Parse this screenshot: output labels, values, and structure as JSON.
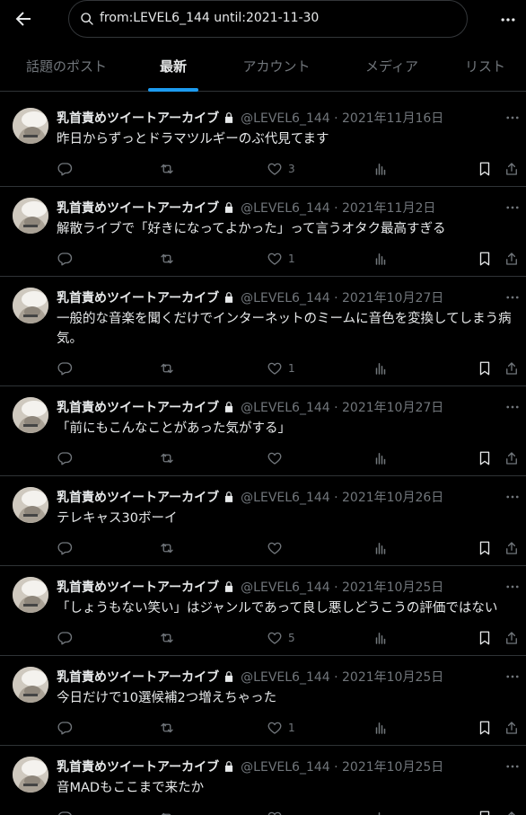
{
  "search": {
    "query": "from:LEVEL6_144 until:2021-11-30"
  },
  "tabs": [
    {
      "label": "話題のポスト",
      "active": false
    },
    {
      "label": "最新",
      "active": true
    },
    {
      "label": "アカウント",
      "active": false
    },
    {
      "label": "メディア",
      "active": false
    },
    {
      "label": "リスト",
      "active": false
    }
  ],
  "tweets": [
    {
      "name": "乳首責めツイートアーカイブ",
      "meta": "@LEVEL6_144 · 2021年11月16日",
      "text": "昨日からずっとドラマツルギーのぶ代見てます",
      "likes": "3"
    },
    {
      "name": "乳首責めツイートアーカイブ",
      "meta": "@LEVEL6_144 · 2021年11月2日",
      "text": "解散ライブで「好きになってよかった」って言うオタク最高すぎる",
      "likes": "1"
    },
    {
      "name": "乳首責めツイートアーカイブ",
      "meta": "@LEVEL6_144 · 2021年10月27日",
      "text": "一般的な音楽を聞くだけでインターネットのミームに音色を変換してしまう病気。",
      "likes": "1"
    },
    {
      "name": "乳首責めツイートアーカイブ",
      "meta": "@LEVEL6_144 · 2021年10月27日",
      "text": "「前にもこんなことがあった気がする」",
      "likes": ""
    },
    {
      "name": "乳首責めツイートアーカイブ",
      "meta": "@LEVEL6_144 · 2021年10月26日",
      "text": "テレキャス30ボーイ",
      "likes": ""
    },
    {
      "name": "乳首責めツイートアーカイブ",
      "meta": "@LEVEL6_144 · 2021年10月25日",
      "text": "「しょうもない笑い」はジャンルであって良し悪しどうこうの評価ではない",
      "likes": "5"
    },
    {
      "name": "乳首責めツイートアーカイブ",
      "meta": "@LEVEL6_144 · 2021年10月25日",
      "text": "今日だけで10選候補2つ増えちゃった",
      "likes": "1"
    },
    {
      "name": "乳首責めツイートアーカイブ",
      "meta": "@LEVEL6_144 · 2021年10月25日",
      "text": "音MADもここまで来たか",
      "likes": ""
    }
  ],
  "icons": {
    "back": "arrow-left-icon",
    "search": "search-icon",
    "more": "more-dots-icon",
    "lock": "lock-icon",
    "reply": "reply-icon",
    "retweet": "retweet-icon",
    "like": "heart-icon",
    "views": "views-chart-icon",
    "bookmark": "bookmark-icon",
    "share": "share-icon"
  },
  "colors": {
    "background": "#000000",
    "accent": "#1d9bf0",
    "muted": "#71767b",
    "text": "#e7e9ea",
    "divider": "#2f3336"
  }
}
